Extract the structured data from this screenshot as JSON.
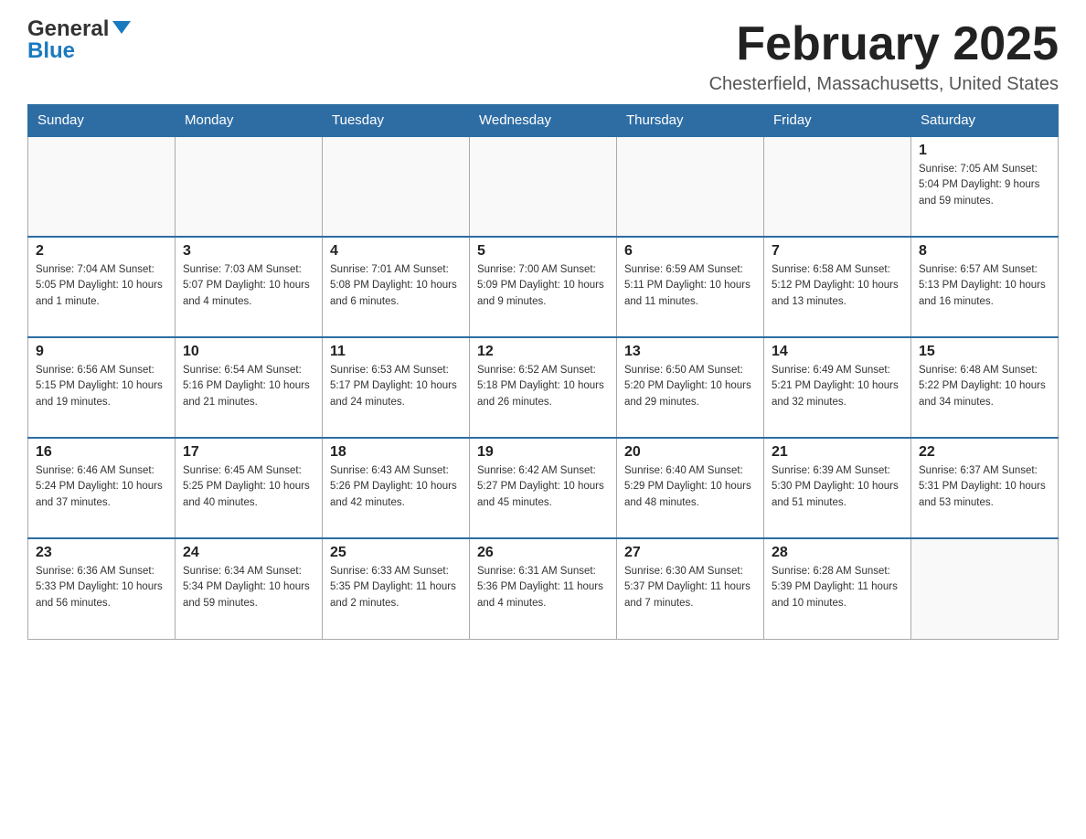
{
  "header": {
    "logo_general": "General",
    "logo_blue": "Blue",
    "month_title": "February 2025",
    "location": "Chesterfield, Massachusetts, United States"
  },
  "calendar": {
    "days_of_week": [
      "Sunday",
      "Monday",
      "Tuesday",
      "Wednesday",
      "Thursday",
      "Friday",
      "Saturday"
    ],
    "weeks": [
      [
        {
          "day": "",
          "info": ""
        },
        {
          "day": "",
          "info": ""
        },
        {
          "day": "",
          "info": ""
        },
        {
          "day": "",
          "info": ""
        },
        {
          "day": "",
          "info": ""
        },
        {
          "day": "",
          "info": ""
        },
        {
          "day": "1",
          "info": "Sunrise: 7:05 AM\nSunset: 5:04 PM\nDaylight: 9 hours and 59 minutes."
        }
      ],
      [
        {
          "day": "2",
          "info": "Sunrise: 7:04 AM\nSunset: 5:05 PM\nDaylight: 10 hours and 1 minute."
        },
        {
          "day": "3",
          "info": "Sunrise: 7:03 AM\nSunset: 5:07 PM\nDaylight: 10 hours and 4 minutes."
        },
        {
          "day": "4",
          "info": "Sunrise: 7:01 AM\nSunset: 5:08 PM\nDaylight: 10 hours and 6 minutes."
        },
        {
          "day": "5",
          "info": "Sunrise: 7:00 AM\nSunset: 5:09 PM\nDaylight: 10 hours and 9 minutes."
        },
        {
          "day": "6",
          "info": "Sunrise: 6:59 AM\nSunset: 5:11 PM\nDaylight: 10 hours and 11 minutes."
        },
        {
          "day": "7",
          "info": "Sunrise: 6:58 AM\nSunset: 5:12 PM\nDaylight: 10 hours and 13 minutes."
        },
        {
          "day": "8",
          "info": "Sunrise: 6:57 AM\nSunset: 5:13 PM\nDaylight: 10 hours and 16 minutes."
        }
      ],
      [
        {
          "day": "9",
          "info": "Sunrise: 6:56 AM\nSunset: 5:15 PM\nDaylight: 10 hours and 19 minutes."
        },
        {
          "day": "10",
          "info": "Sunrise: 6:54 AM\nSunset: 5:16 PM\nDaylight: 10 hours and 21 minutes."
        },
        {
          "day": "11",
          "info": "Sunrise: 6:53 AM\nSunset: 5:17 PM\nDaylight: 10 hours and 24 minutes."
        },
        {
          "day": "12",
          "info": "Sunrise: 6:52 AM\nSunset: 5:18 PM\nDaylight: 10 hours and 26 minutes."
        },
        {
          "day": "13",
          "info": "Sunrise: 6:50 AM\nSunset: 5:20 PM\nDaylight: 10 hours and 29 minutes."
        },
        {
          "day": "14",
          "info": "Sunrise: 6:49 AM\nSunset: 5:21 PM\nDaylight: 10 hours and 32 minutes."
        },
        {
          "day": "15",
          "info": "Sunrise: 6:48 AM\nSunset: 5:22 PM\nDaylight: 10 hours and 34 minutes."
        }
      ],
      [
        {
          "day": "16",
          "info": "Sunrise: 6:46 AM\nSunset: 5:24 PM\nDaylight: 10 hours and 37 minutes."
        },
        {
          "day": "17",
          "info": "Sunrise: 6:45 AM\nSunset: 5:25 PM\nDaylight: 10 hours and 40 minutes."
        },
        {
          "day": "18",
          "info": "Sunrise: 6:43 AM\nSunset: 5:26 PM\nDaylight: 10 hours and 42 minutes."
        },
        {
          "day": "19",
          "info": "Sunrise: 6:42 AM\nSunset: 5:27 PM\nDaylight: 10 hours and 45 minutes."
        },
        {
          "day": "20",
          "info": "Sunrise: 6:40 AM\nSunset: 5:29 PM\nDaylight: 10 hours and 48 minutes."
        },
        {
          "day": "21",
          "info": "Sunrise: 6:39 AM\nSunset: 5:30 PM\nDaylight: 10 hours and 51 minutes."
        },
        {
          "day": "22",
          "info": "Sunrise: 6:37 AM\nSunset: 5:31 PM\nDaylight: 10 hours and 53 minutes."
        }
      ],
      [
        {
          "day": "23",
          "info": "Sunrise: 6:36 AM\nSunset: 5:33 PM\nDaylight: 10 hours and 56 minutes."
        },
        {
          "day": "24",
          "info": "Sunrise: 6:34 AM\nSunset: 5:34 PM\nDaylight: 10 hours and 59 minutes."
        },
        {
          "day": "25",
          "info": "Sunrise: 6:33 AM\nSunset: 5:35 PM\nDaylight: 11 hours and 2 minutes."
        },
        {
          "day": "26",
          "info": "Sunrise: 6:31 AM\nSunset: 5:36 PM\nDaylight: 11 hours and 4 minutes."
        },
        {
          "day": "27",
          "info": "Sunrise: 6:30 AM\nSunset: 5:37 PM\nDaylight: 11 hours and 7 minutes."
        },
        {
          "day": "28",
          "info": "Sunrise: 6:28 AM\nSunset: 5:39 PM\nDaylight: 11 hours and 10 minutes."
        },
        {
          "day": "",
          "info": ""
        }
      ]
    ]
  }
}
